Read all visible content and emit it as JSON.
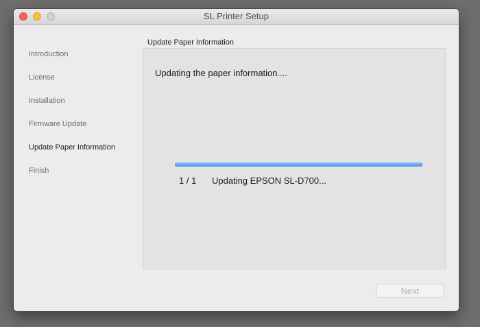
{
  "window": {
    "title": "SL Printer Setup"
  },
  "sidebar": {
    "items": [
      {
        "label": "Introduction"
      },
      {
        "label": "License"
      },
      {
        "label": "Installation"
      },
      {
        "label": "Firmware Update"
      },
      {
        "label": "Update Paper Information",
        "active": true
      },
      {
        "label": "Finish"
      }
    ]
  },
  "main": {
    "section_title": "Update Paper Information",
    "message": "Updating the paper information....",
    "progress_fraction": 1.0,
    "counter": "1 / 1",
    "status_text": "Updating EPSON SL-D700..."
  },
  "footer": {
    "next_label": "Next",
    "next_enabled": false
  },
  "colors": {
    "progress_fill": "#4a90e2",
    "close_button": "#fc605c",
    "minimize_button": "#fdbc40"
  }
}
